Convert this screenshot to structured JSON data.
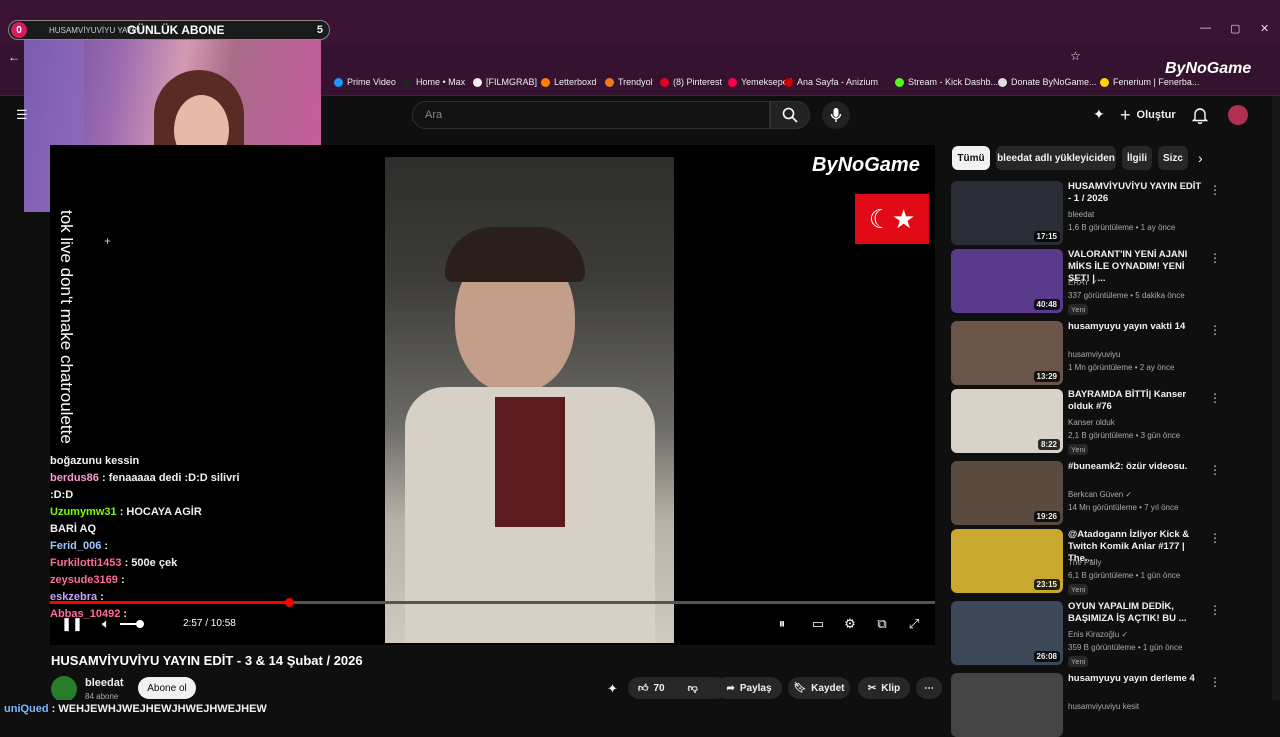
{
  "overlay": {
    "count": "0",
    "channel": "HUSAMVİYUVİYU YAYIN",
    "title": "GÜNLÜK ABONE",
    "goal": "5"
  },
  "bookmarks": [
    {
      "label": "Prime Video",
      "color": "#1a98ff"
    },
    {
      "label": "Home • Max",
      "color": "#222"
    },
    {
      "label": "[FILMGRAB]",
      "color": "#eee"
    },
    {
      "label": "Letterboxd",
      "color": "#ff8000"
    },
    {
      "label": "Trendyol",
      "color": "#f27a1a"
    },
    {
      "label": "(8) Pinterest",
      "color": "#e60023"
    },
    {
      "label": "Yemeksepeti",
      "color": "#fa0050"
    },
    {
      "label": "Ana Sayfa - Anizium",
      "color": "#c00"
    },
    {
      "label": "Stream - Kick Dashb...",
      "color": "#53fc18"
    },
    {
      "label": "Donate ByNoGame...",
      "color": "#ddd"
    },
    {
      "label": "Fenerium | Fenerba...",
      "color": "#ffd500"
    }
  ],
  "brand": "ByNoGame",
  "search": {
    "placeholder": "Ara"
  },
  "header": {
    "create": "Oluştur"
  },
  "video": {
    "vertical_text": "tok live don't make chatroulette",
    "time": "2:57 / 10:58",
    "progress": 0.27,
    "title": "HUSAMVİYUVİYU YAYIN EDİT - 3 & 14 Şubat / 2026"
  },
  "chat": [
    {
      "user": "",
      "msg": "boğazunu kessin",
      "color": "#fff"
    },
    {
      "user": "berdus86",
      "msg": " : fenaaaaa dedi :D:D silivri",
      "color": "#ff9bd0"
    },
    {
      "user": "",
      "msg": ":D:D",
      "color": "#fff"
    },
    {
      "user": "Uzumymw31",
      "msg": " : HOCAYA AGİR",
      "color": "#7cfc00"
    },
    {
      "user": "",
      "msg": "BARİ AQ",
      "color": "#fff"
    },
    {
      "user": "Ferid_006",
      "msg": " :",
      "color": "#9ec9ff"
    },
    {
      "user": "Furkilotti1453",
      "msg": " : 500e çek",
      "color": "#ff6aa2"
    },
    {
      "user": "zeysude3169",
      "msg": " :",
      "color": "#ff6aa2"
    },
    {
      "user": "eskzebra",
      "msg": " :",
      "color": "#c9a0ff"
    },
    {
      "user": "Abbas_10492",
      "msg": " :",
      "color": "#ff6aa2"
    }
  ],
  "channel": {
    "name": "bleedat",
    "subs": "84 abone",
    "subscribe": "Abone ol"
  },
  "actions": {
    "likes": "70",
    "share": "Paylaş",
    "save": "Kaydet",
    "clip": "Klip"
  },
  "ticker": {
    "user": "uniQued",
    "msg": " : WEHJEWHJWEJHEWJHWEJHWEJHEW"
  },
  "chips": [
    "Tümü",
    "bleedat adlı yükleyiciden",
    "İlgili",
    "Sizc"
  ],
  "recommendations": [
    {
      "title": "HUSAMVİYUVİYU YAYIN EDİT - 1 / 2026",
      "channel": "bleedat",
      "meta": "1,6 B görüntüleme • 1 ay önce",
      "duration": "17:15",
      "new": "",
      "thumb": "#2a2d35"
    },
    {
      "title": "VALORANT'IN YENİ AJANI MİKS İLE OYNADIM! YENİ SET! | ...",
      "channel": "ERAY ✓",
      "meta": "337 görüntüleme • 5 dakika önce",
      "duration": "40:48",
      "new": "Yeni",
      "thumb": "#5a3a8a"
    },
    {
      "title": "husamyuyu yayın vakti 14",
      "channel": "husamviyuviyu",
      "meta": "1 Mn görüntüleme • 2 ay önce",
      "duration": "13:29",
      "new": "",
      "thumb": "#6a5548"
    },
    {
      "title": "BAYRAMDA BİTTİ| Kanser olduk #76",
      "channel": "Kanser olduk",
      "meta": "2,1 B görüntüleme • 3 gün önce",
      "duration": "8:22",
      "new": "Yeni",
      "thumb": "#d8d2c8"
    },
    {
      "title": "#buneamk2: özür videosu.",
      "channel": "Berkcan Güven ✓",
      "meta": "14 Mn görüntüleme • 7 yıl önce",
      "duration": "19:26",
      "new": "",
      "thumb": "#5b4a3e"
    },
    {
      "title": "@Atadogann İzliyor Kick & Twitch Komik Anlar #177 | The...",
      "channel": "The Pally",
      "meta": "6,1 B görüntüleme • 1 gün önce",
      "duration": "23:15",
      "new": "Yeni",
      "thumb": "#c9a830"
    },
    {
      "title": "OYUN YAPALIM DEDİK, BAŞIMIZA İŞ AÇTIK! BU ...",
      "channel": "Enis Kirazoğlu ✓",
      "meta": "359 B görüntüleme • 1 gün önce",
      "duration": "26:08",
      "new": "Yeni",
      "thumb": "#3a4858"
    },
    {
      "title": "husamyuyu yayın derleme 4",
      "channel": "husamviyuviyu kesit",
      "meta": "",
      "duration": "",
      "new": "",
      "thumb": "#444"
    }
  ]
}
